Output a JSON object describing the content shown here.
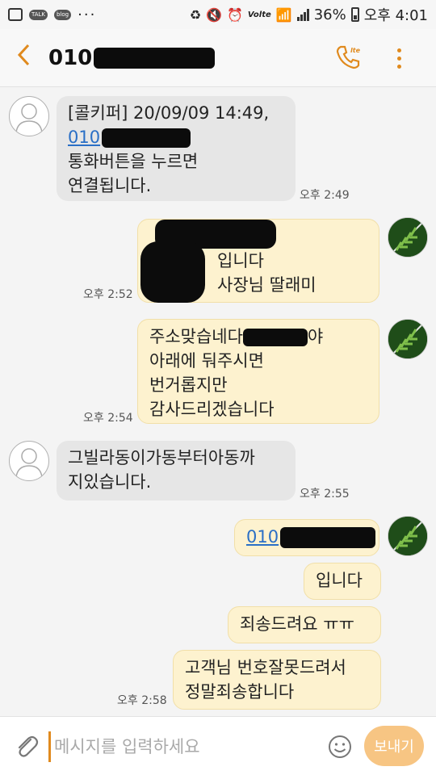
{
  "status_bar": {
    "talk_label": "TALK",
    "blog_label": "blog",
    "more_dots": "···",
    "volte_label": "Volte",
    "battery_percent": "36%",
    "time": "오후 4:01"
  },
  "header": {
    "title_prefix": "010",
    "call_icon": "phone-volte-icon",
    "menu_icon": "more-vert-icon",
    "back_icon": "chevron-left-icon"
  },
  "messages": [
    {
      "dir": "in",
      "lines": [
        "[콜키퍼] 20/09/09 14:49,",
        "010",
        "통화버튼을 누르면",
        "연결됩니다."
      ],
      "time": "오후 2:49"
    },
    {
      "dir": "out",
      "lines": [
        "입니다",
        "사장님 딸래미"
      ],
      "time": "오후 2:52"
    },
    {
      "dir": "out",
      "lines": [
        "주소맞습네다",
        "야",
        "아래에 둬주시면",
        "번거롭지만",
        "감사드리겠습니다"
      ],
      "time": "오후 2:54"
    },
    {
      "dir": "in",
      "lines": [
        "그빌라동이가동부터아동까",
        "지있습니다."
      ],
      "time": "오후 2:55"
    },
    {
      "dir": "out",
      "lines": [
        "010"
      ],
      "time": ""
    },
    {
      "dir": "out",
      "lines": [
        "입니다"
      ],
      "time": ""
    },
    {
      "dir": "out",
      "lines": [
        "죄송드려요 ㅠㅠ"
      ],
      "time": ""
    },
    {
      "dir": "out",
      "lines": [
        "고객님 번호잘못드려서",
        "정말죄송합니다"
      ],
      "time": "오후 2:58"
    }
  ],
  "input": {
    "placeholder": "메시지를 입력하세요",
    "send_label": "보내기"
  },
  "colors": {
    "accent": "#e08a1e",
    "bubble_out": "#fdf2cf",
    "bubble_in": "#e6e6e6",
    "link": "#2a6fc6",
    "send_button": "#f7c583"
  }
}
